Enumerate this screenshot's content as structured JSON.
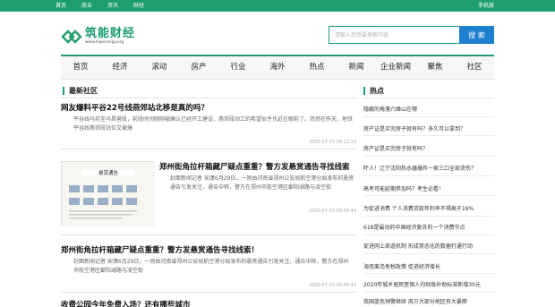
{
  "topbar": {
    "nav": [
      "首页",
      "商业",
      "资讯",
      "财经"
    ],
    "mobile": "手机版"
  },
  "logo": {
    "name": "筑能财经",
    "url": "www.topenergy.org"
  },
  "search": {
    "placeholder": "请输入您想要搜索内容",
    "button": "搜 索"
  },
  "mainnav": [
    "首页",
    "经济",
    "滚动",
    "房产",
    "行业",
    "海外",
    "热点",
    "新闻",
    "企业新闻",
    "聚焦",
    "社区"
  ],
  "latest": {
    "title": "最新社区",
    "articles": [
      {
        "title": "网友爆料平谷22号线燕郊站北移是真的吗？",
        "desc": "平谷线马坊至马昌营段，前段时间刚刚被确认已经开工建设，燕郊段动工的希望似乎也近在眼前了。忽然在昨天，地铁平谷线燕郊段站位又被爆",
        "time": "2020-07-03 09:12:19"
      },
      {
        "title": "郑州街角拉杆箱藏尸疑点重重？警方发悬赏通告寻找线索",
        "desc": "封面新闻记者 宋潇6月29日，一则由河南省郑州公安局航空港分局发布的悬赏通告引发关注，通告中称，警方在郑州市航空港区鄱阳湖路与凌空街",
        "time": "2020-07-03 09:09:44"
      },
      {
        "title": "郑州街角拉杆箱藏尸疑点重重？警方发悬赏通告寻找线索！",
        "desc": "封面新闻记者 宋潇6月29日，一则由河南省郑州公安局航空港分局发布的悬赏通告引发关注，通告中称，警方在郑州市航空港区鄱阳湖路与凌空街",
        "time": "2020-07-03 09:09:44"
      },
      {
        "title": "收费公园今年免费入场？还有哪些城市",
        "desc": "",
        "time": ""
      }
    ],
    "thumb_caption": "悬赏通告"
  },
  "hot": {
    "title": "热点",
    "items": [
      "隐蔽的角落六峰山在哪",
      "房产证是买完房子就有吗？多久可以拿到？",
      "房产证是买完房子就有吗？",
      "吓人！辽宁沈阳热水器爆炸一家三口全部烫伤？",
      "高考可能延期参加吗？考生必看！",
      "为促进消费 个人消费贷款年利率不得高于16%",
      "618是最动的中国经济复苏的一个消费节点",
      "促进网上商道机制 形成常态化的数据打通行动",
      "海南离岛免税政策 促进经济增长",
      "2020年城乡居民医保人均财政补助标准新增30元",
      "我国蓝色预警继续 南方大部分地区有大暴雨"
    ]
  },
  "colors": {
    "brand": "#1f9e6e",
    "search_button": "#1f7fd0"
  }
}
